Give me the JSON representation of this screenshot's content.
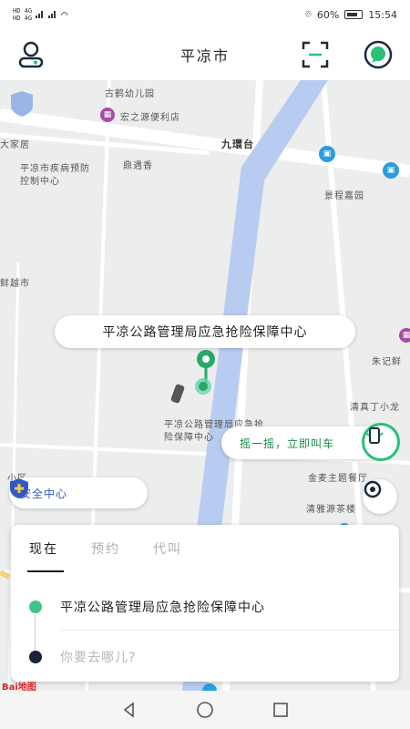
{
  "status": {
    "network_top": "HD 4G",
    "network_bottom": "HD 4G",
    "battery": "60%",
    "time": "15:54"
  },
  "header": {
    "title": "平凉市"
  },
  "map": {
    "labels": {
      "kindergarten": "古鹤幼儿园",
      "store": "宏之源便利店",
      "jiuhuantai": "九環台",
      "dajiaju": "大家居",
      "cdc": "平凉市疾病预防控制中心",
      "dingyuanxiang": "鼎遇香",
      "jingcheng": "景程嘉园",
      "city": "鲜越市",
      "zhuji": "朱记鲜",
      "qingjing": "清真丁小龙",
      "jinmai": "金麦主题餐厅",
      "qingya": "清雅源茶楼",
      "xiaoqu": "小区",
      "origin_label": "平凉公路管理局应急抢险保障中心"
    },
    "callout": "平凉公路管理局应急抢险保障中心",
    "shake_hint": "摇一摇，立即叫车",
    "safety_center": "安全中心"
  },
  "card": {
    "tabs": [
      "现在",
      "预约",
      "代叫"
    ],
    "origin": "平凉公路管理局应急抢险保障中心",
    "destination_placeholder": "你要去哪儿?"
  },
  "logo": "Bai地图",
  "colors": {
    "accent_green": "#27c17a",
    "river": "#b8cbf0",
    "safety_blue": "#2f59c7"
  }
}
